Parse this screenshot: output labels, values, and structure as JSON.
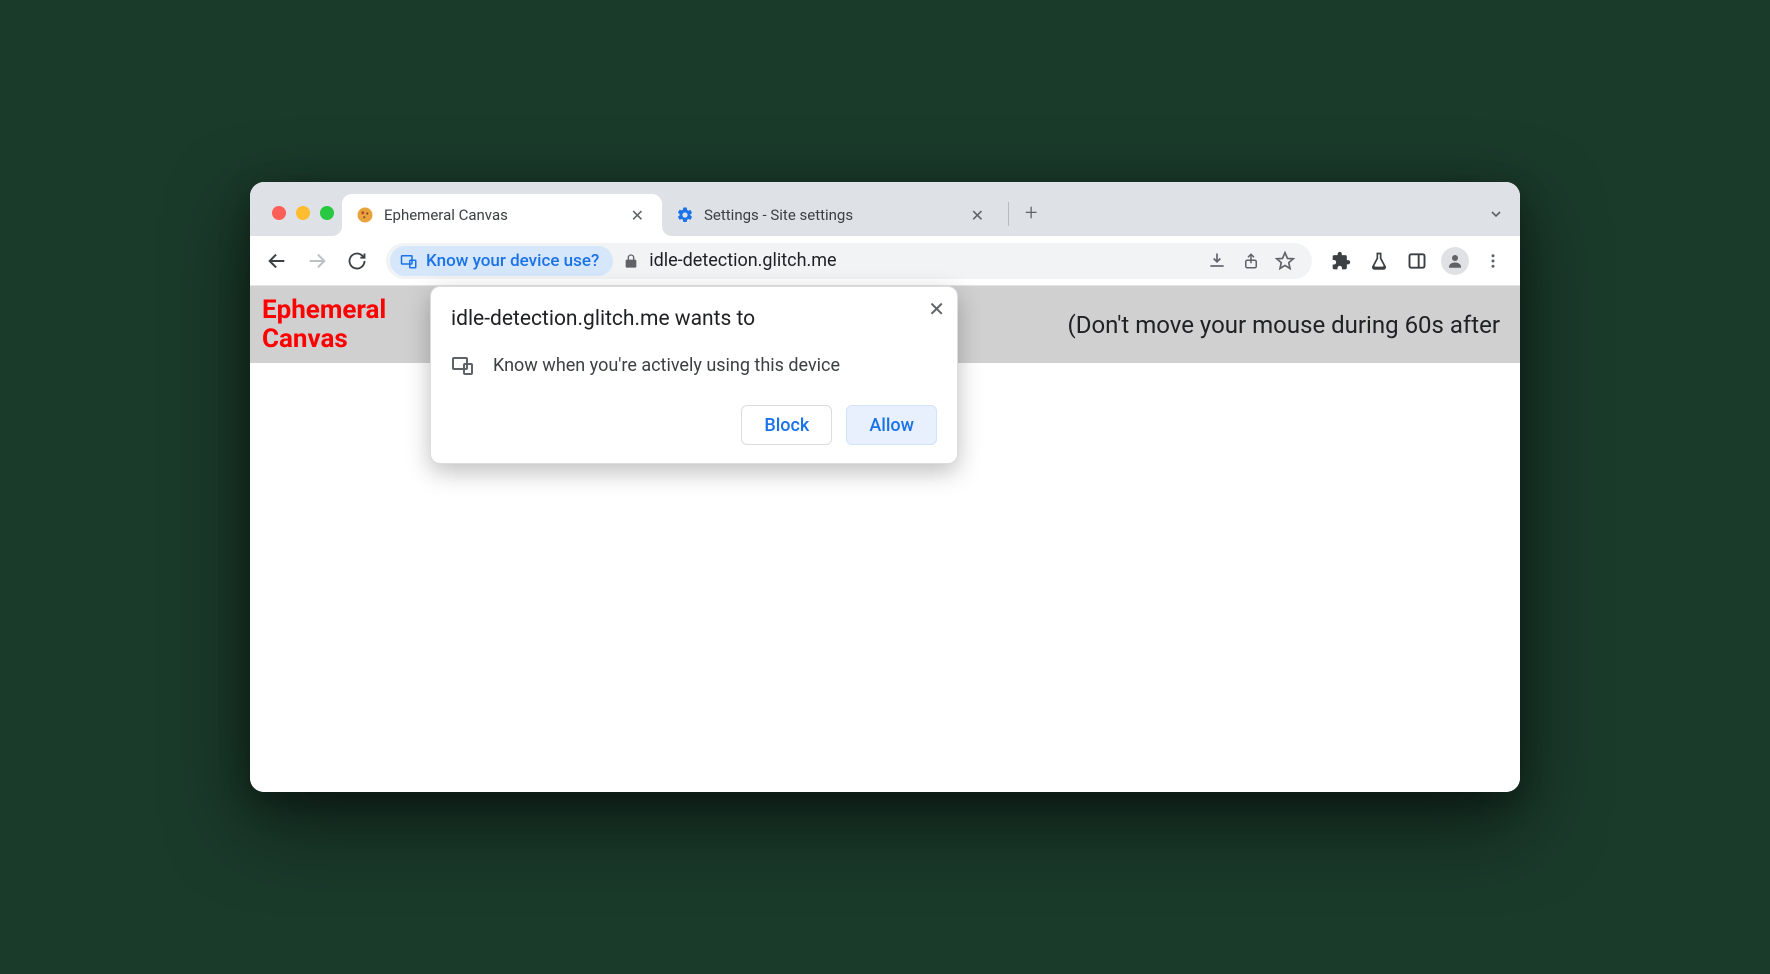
{
  "tabs": [
    {
      "title": "Ephemeral Canvas",
      "favicon": "🎨"
    },
    {
      "title": "Settings - Site settings",
      "favicon": "gear"
    }
  ],
  "omnibox": {
    "chip_label": "Know your device use?",
    "url": "idle-detection.glitch.me"
  },
  "page": {
    "banner_title": "Ephemeral Canvas",
    "banner_text": "(Don't move your mouse during 60s after"
  },
  "permission": {
    "title": "idle-detection.glitch.me wants to",
    "item": "Know when you're actively using this device",
    "block": "Block",
    "allow": "Allow"
  }
}
